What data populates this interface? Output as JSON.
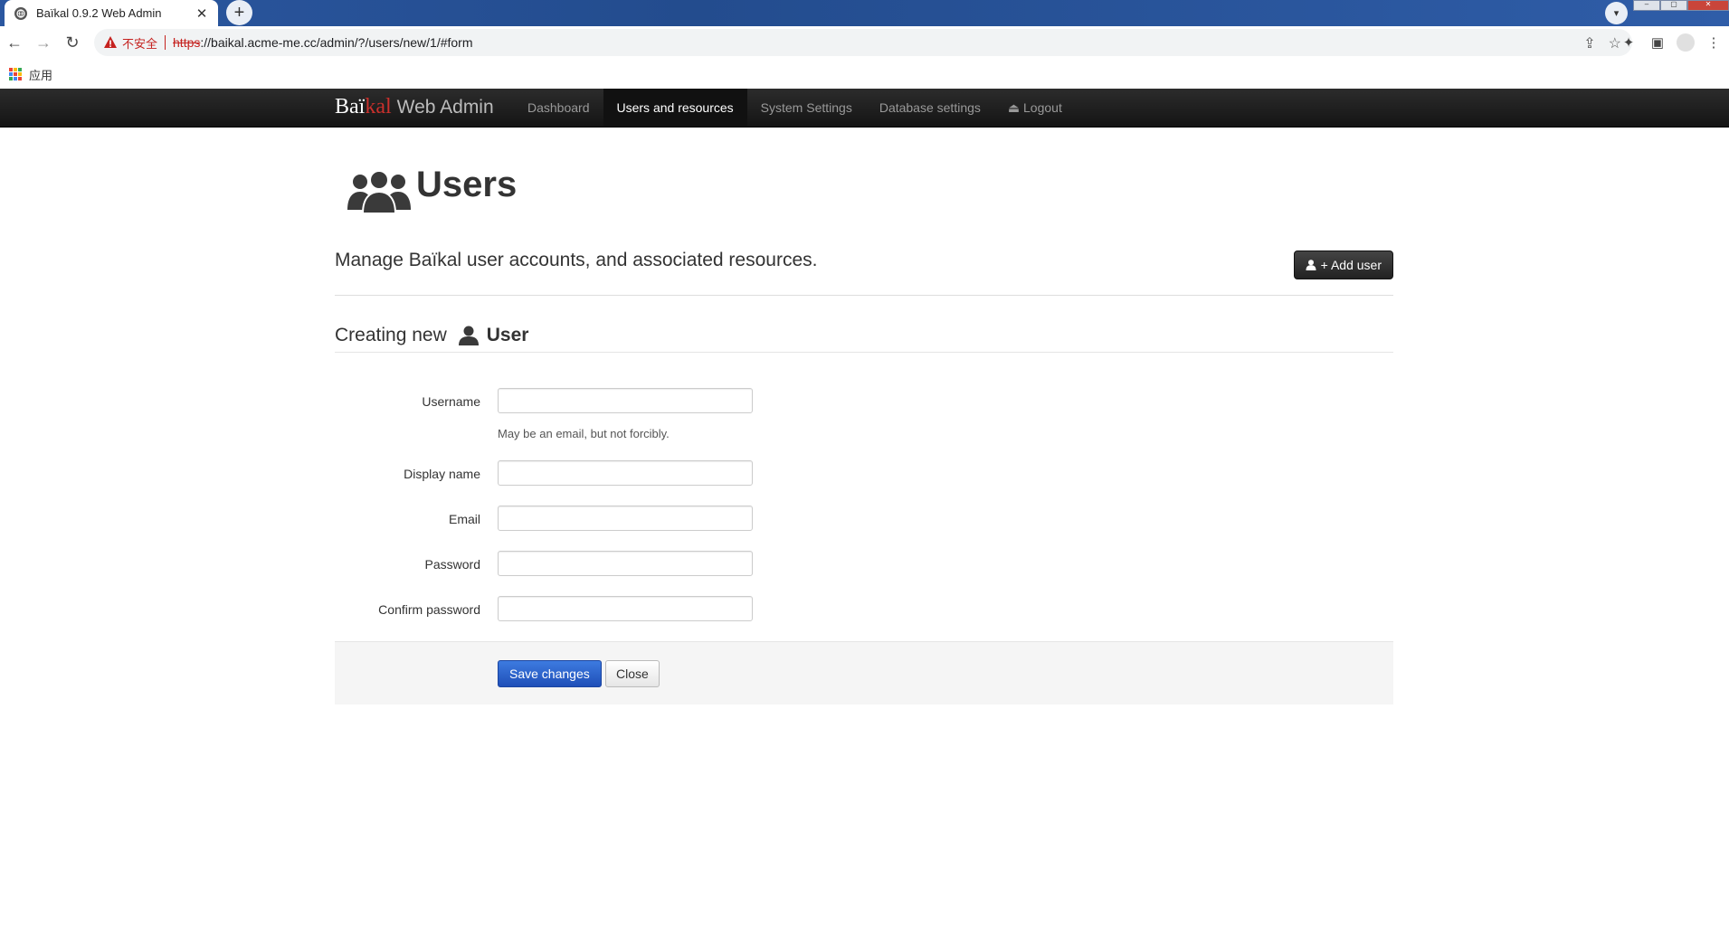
{
  "browser": {
    "tab_title": "Baïkal 0.9.2 Web Admin",
    "tab_close": "✕",
    "new_tab": "+",
    "insecure_label": "不安全",
    "url_scheme": "https",
    "url_rest": "://baikal.acme-me.cc/admin/?/users/new/1/#form",
    "bookmark_apps_label": "应用"
  },
  "navbar": {
    "brand_part1": "Baï",
    "brand_part2": "kal",
    "brand_part3": "Web Admin",
    "links": [
      {
        "label": "Dashboard"
      },
      {
        "label": "Users and resources"
      },
      {
        "label": "System Settings"
      },
      {
        "label": "Database settings"
      },
      {
        "label": "⏏ Logout"
      }
    ]
  },
  "page": {
    "title": "Users",
    "lead": "Manage Baïkal user accounts, and associated resources.",
    "add_user_label": "+ Add user"
  },
  "form": {
    "heading_prefix": "Creating new",
    "heading_entity": "User",
    "fields": [
      {
        "label": "Username",
        "value": "",
        "help": "May be an email, but not forcibly."
      },
      {
        "label": "Display name",
        "value": ""
      },
      {
        "label": "Email",
        "value": ""
      },
      {
        "label": "Password",
        "value": ""
      },
      {
        "label": "Confirm password",
        "value": ""
      }
    ],
    "save_label": "Save changes",
    "close_label": "Close"
  },
  "colors": {
    "navbar_bg": "#1b1b1b",
    "brand_accent": "#c9302c",
    "primary_button": "#2a5fcc",
    "insecure_red": "#c5221f"
  },
  "icons": {
    "page": "users-group-icon",
    "heading": "user-icon",
    "add": "user-icon"
  }
}
